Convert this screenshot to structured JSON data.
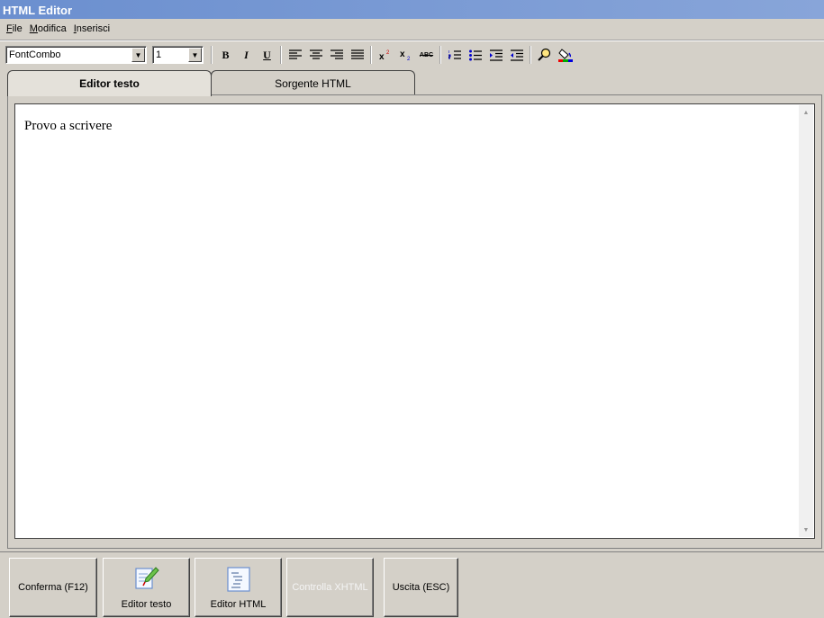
{
  "window": {
    "title": "HTML Editor"
  },
  "menu": [
    {
      "accel": "F",
      "rest": "ile"
    },
    {
      "accel": "M",
      "rest": "odifica"
    },
    {
      "accel": "I",
      "rest": "nserisci"
    }
  ],
  "toolbar": {
    "font_combo_value": "FontCombo",
    "size_combo_value": "1",
    "bold": "B",
    "italic": "I",
    "underline": "U",
    "abc": "ABC"
  },
  "tabs": [
    {
      "label": "Editor testo",
      "active": true
    },
    {
      "label": "Sorgente HTML",
      "active": false
    }
  ],
  "editor": {
    "content": "Provo a scrivere"
  },
  "buttons": {
    "confirm": "Conferma (F12)",
    "text_editor": "Editor testo",
    "html_editor": "Editor HTML",
    "check_xhtml": "Controlla XHTML",
    "exit": "Uscita (ESC)"
  },
  "colors": {
    "titlebar": "#6b8fcf",
    "face": "#d4d0c8"
  }
}
